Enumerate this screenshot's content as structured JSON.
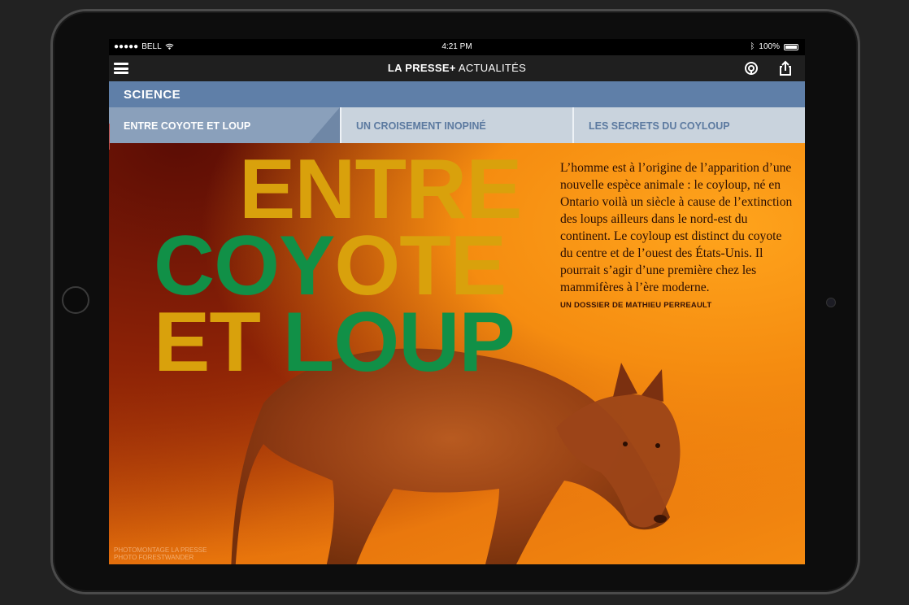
{
  "status_bar": {
    "carrier": "BELL",
    "time": "4:21 PM",
    "battery": "100%"
  },
  "nav": {
    "brand_bold": "LA PRESSE+",
    "brand_section": " ACTUALITÉS"
  },
  "section": {
    "title": "SCIENCE"
  },
  "tabs": [
    {
      "label": "ENTRE COYOTE ET LOUP",
      "active": true
    },
    {
      "label": "UN CROISEMENT INOPINÉ",
      "active": false
    },
    {
      "label": "LES SECRETS DU COYLOUP",
      "active": false
    }
  ],
  "hero": {
    "headline_line1": "ENTRE",
    "headline_line2a": "COY",
    "headline_line2b": "OTE",
    "headline_line3a": "ET ",
    "headline_line3b": "LOUP",
    "deck": "L’homme est à l’origine de l’apparition d’une nouvelle espèce animale : le coyloup, né en Ontario voilà un siècle à cause de l’extinction des loups ailleurs dans le nord-est du continent. Le coyloup est distinct du coyote du centre et de l’ouest des États-Unis. Il pourrait s’agir d’une première chez les mammifères à l’ère moderne.",
    "byline": "UN DOSSIER DE MATHIEU PERREAULT",
    "credit_line1": "PHOTOMONTAGE LA PRESSE",
    "credit_line2": "PHOTO FORESTWANDER"
  },
  "colors": {
    "section_band": "#5f7fa8",
    "headline_gold": "#d9a10c",
    "headline_green": "#119047"
  }
}
